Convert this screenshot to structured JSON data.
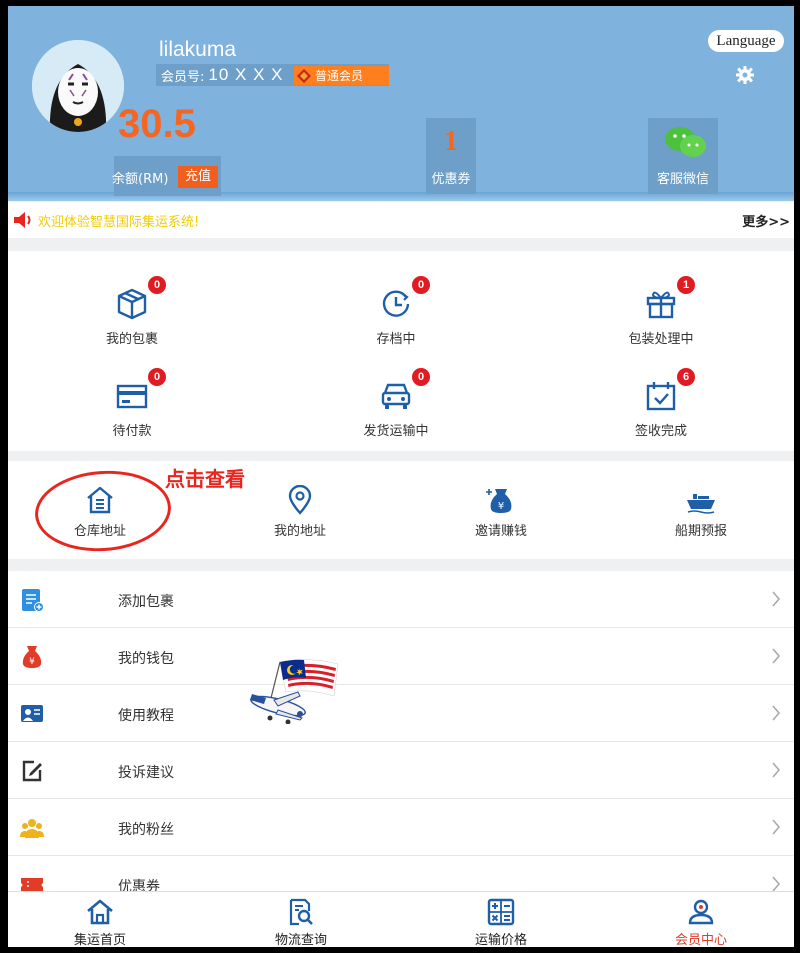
{
  "header": {
    "username": "lilakuma",
    "member_label": "会员号:",
    "member_no": "10 X X X",
    "level": "普通会员",
    "language_btn": "Language",
    "balance_value": "30.5",
    "balance_label": "余额(RM)",
    "recharge_label": "充值",
    "coupon_value": "1",
    "coupon_label": "优惠券",
    "wechat_label": "客服微信"
  },
  "notice": {
    "text": "欢迎体验智慧国际集运系统!",
    "more": "更多>>"
  },
  "status_items": [
    {
      "label": "我的包裹",
      "count": "0",
      "icon": "package-icon"
    },
    {
      "label": "存档中",
      "count": "0",
      "icon": "clock-icon"
    },
    {
      "label": "包装处理中",
      "count": "1",
      "icon": "gift-icon"
    },
    {
      "label": "待付款",
      "count": "0",
      "icon": "wallet-card-icon"
    },
    {
      "label": "发货运输中",
      "count": "0",
      "icon": "truck-icon"
    },
    {
      "label": "签收完成",
      "count": "6",
      "icon": "calendar-check-icon"
    }
  ],
  "shortcuts": [
    {
      "label": "仓库地址",
      "icon": "warehouse-icon"
    },
    {
      "label": "我的地址",
      "icon": "location-pin-icon"
    },
    {
      "label": "邀请赚钱",
      "icon": "money-bag-icon"
    },
    {
      "label": "船期预报",
      "icon": "ship-icon"
    }
  ],
  "annotation": "点击查看",
  "menu": [
    {
      "label": "添加包裹",
      "icon": "add-document-icon",
      "color": "#2f8fe0"
    },
    {
      "label": "我的钱包",
      "icon": "money-bag-icon",
      "color": "#e23b28"
    },
    {
      "label": "使用教程",
      "icon": "tutorial-icon",
      "color": "#1f5fa8"
    },
    {
      "label": "投诉建议",
      "icon": "edit-icon",
      "color": "#333333"
    },
    {
      "label": "我的粉丝",
      "icon": "users-icon",
      "color": "#f0b21a"
    },
    {
      "label": "优惠券",
      "icon": "coupon-icon",
      "color": "#e23b28"
    }
  ],
  "bottom_nav": [
    {
      "label": "集运首页",
      "icon": "home-icon",
      "active": false
    },
    {
      "label": "物流查询",
      "icon": "search-doc-icon",
      "active": false
    },
    {
      "label": "运输价格",
      "icon": "calculator-icon",
      "active": false
    },
    {
      "label": "会员中心",
      "icon": "user-icon",
      "active": true
    }
  ],
  "colors": {
    "header_bg": "#7fb2dc",
    "accent_orange": "#f46622",
    "badge_red": "#e01b22",
    "icon_blue": "#1f5fa8",
    "active_nav": "#e23b28"
  }
}
